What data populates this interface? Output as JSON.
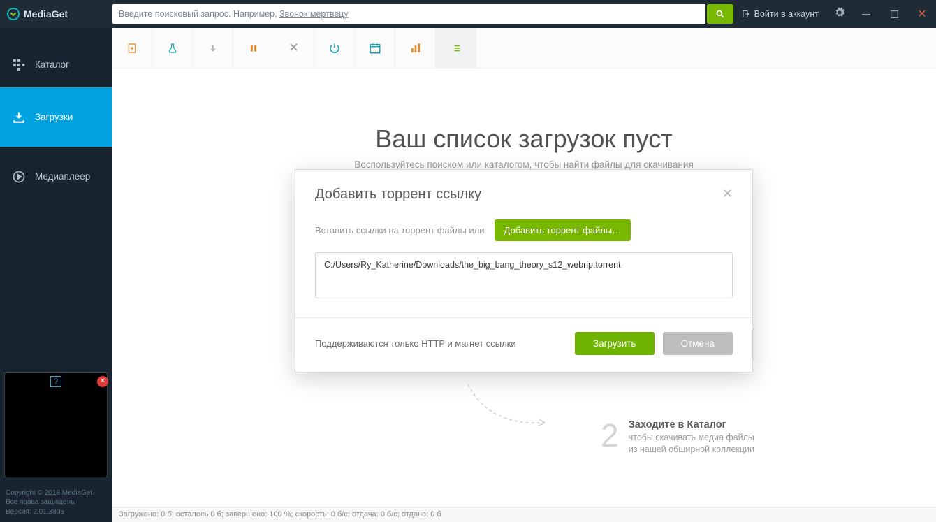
{
  "app": {
    "name": "MediaGet"
  },
  "search": {
    "placeholder_prefix": "Введите поисковый запрос. Например, ",
    "placeholder_example": "Звонок мертвецу",
    "value": ""
  },
  "header": {
    "login": "Войти в аккаунт"
  },
  "sidebar": {
    "items": [
      {
        "label": "Каталог"
      },
      {
        "label": "Загрузки"
      },
      {
        "label": "Медиаплеер"
      }
    ],
    "footer": {
      "copyright": "Copyright © 2018 MediaGet",
      "rights": "Все права защищены",
      "version": "Версия: 2.01.3805"
    }
  },
  "empty": {
    "title": "Ваш список загрузок пуст",
    "subtitle": "Воспользуйтесь поиском или каталогом, чтобы найти файлы для скачивания",
    "step2": {
      "num": "2",
      "title": "Заходите в Каталог",
      "line1": "чтобы скачивать медиа файлы",
      "line2": "из нашей обширной коллекции"
    }
  },
  "modal": {
    "title": "Добавить торрент ссылку",
    "insert_label": "Вставить ссылки на торрент файлы или",
    "add_files_btn": "Добавить торрент файлы…",
    "textarea_value": "C:/Users/Ry_Katherine/Downloads/the_big_bang_theory_s12_webrip.torrent",
    "hint": "Поддерживаются только HTTP и магнет ссылки",
    "load_btn": "Загрузить",
    "cancel_btn": "Отмена"
  },
  "status": {
    "text": "Загружено: 0 б; осталось 0 б; завершено: 100 %; скорость: 0 б/с; отдача: 0 б/с; отдано: 0 б"
  }
}
